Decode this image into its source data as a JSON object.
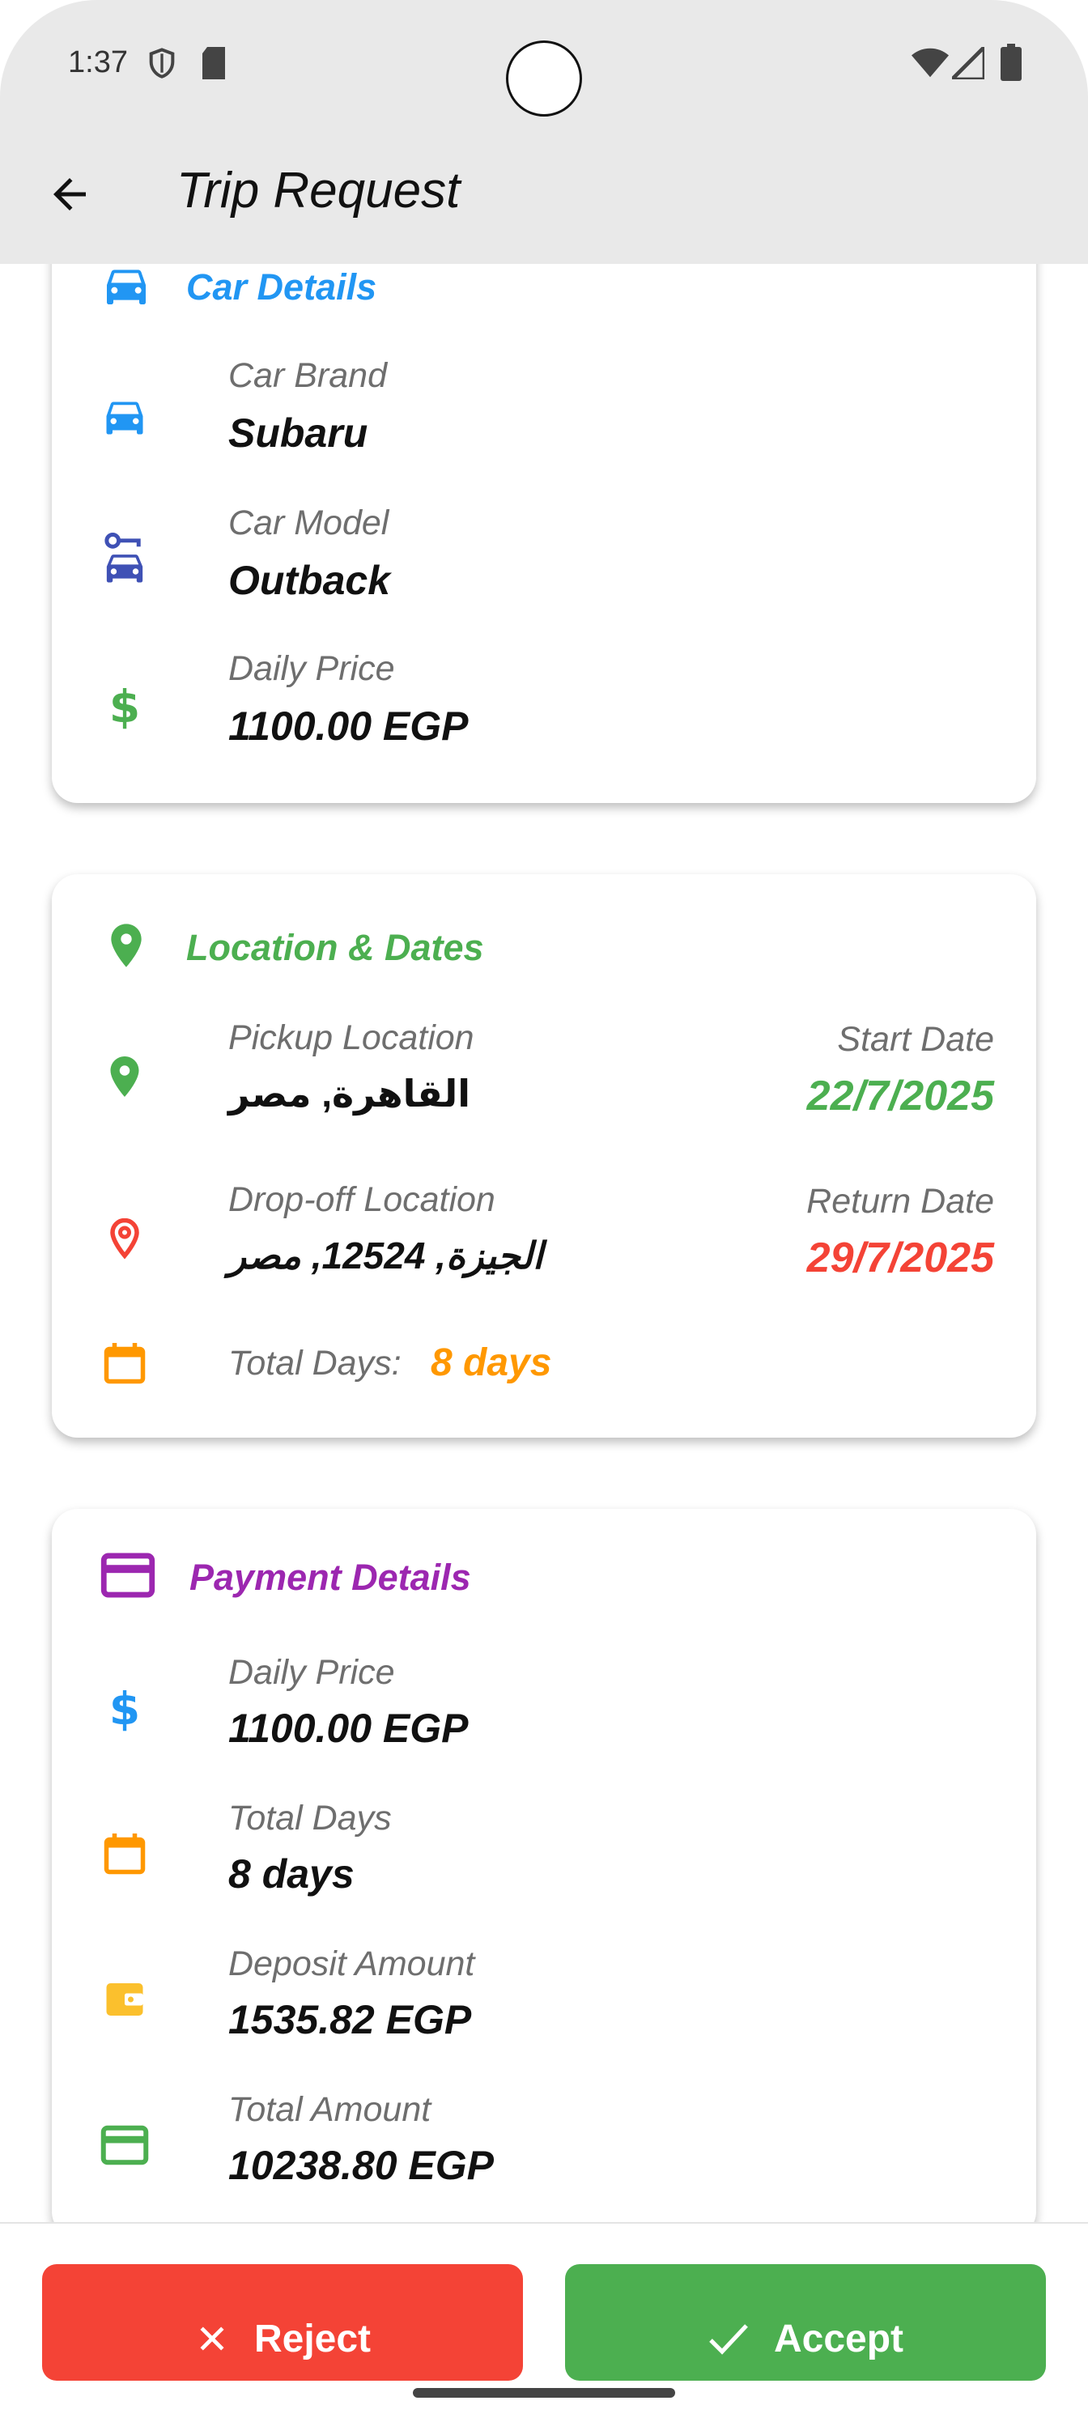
{
  "status_bar": {
    "time": "1:37"
  },
  "app_bar": {
    "title": "Trip Request"
  },
  "car_details": {
    "title": "Car Details",
    "title_color": "#2196f3",
    "brand_label": "Car Brand",
    "brand_value": "Subaru",
    "model_label": "Car Model",
    "model_value": "Outback",
    "price_label": "Daily Price",
    "price_value": "1100.00 EGP"
  },
  "location_dates": {
    "title": "Location & Dates",
    "title_color": "#4caf50",
    "pickup_label": "Pickup Location",
    "pickup_value": "القاهرة, مصر",
    "start_label": "Start Date",
    "start_value": "22/7/2025",
    "dropoff_label": "Drop-off Location",
    "dropoff_value": "الجيزة, 12524, مصر",
    "return_label": "Return Date",
    "return_value": "29/7/2025",
    "total_days_label": "Total Days:",
    "total_days_value": "8 days"
  },
  "payment_details": {
    "title": "Payment Details",
    "title_color": "#9c27b0",
    "daily_label": "Daily Price",
    "daily_value": "1100.00 EGP",
    "days_label": "Total Days",
    "days_value": "8 days",
    "deposit_label": "Deposit Amount",
    "deposit_value": "1535.82 EGP",
    "total_label": "Total Amount",
    "total_value": "10238.80 EGP"
  },
  "actions": {
    "reject_label": "Reject",
    "accept_label": "Accept",
    "reject_color": "#f44336",
    "accept_color": "#4caf50"
  }
}
